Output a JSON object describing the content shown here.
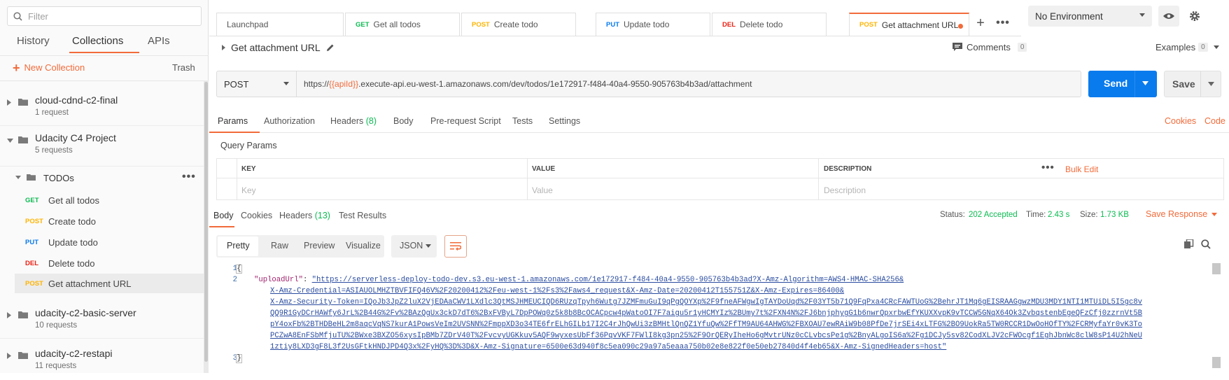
{
  "sidebar": {
    "search_placeholder": "Filter",
    "tabs": [
      "History",
      "Collections",
      "APIs"
    ],
    "new_collection": "New Collection",
    "trash": "Trash",
    "collections": [
      {
        "name": "cloud-cdnd-c2-final",
        "sub": "1 request"
      },
      {
        "name": "Udacity C4 Project",
        "sub": "5 requests"
      },
      {
        "name": "udacity-c2-basic-server",
        "sub": "10 requests"
      },
      {
        "name": "udacity-c2-restapi",
        "sub": "11 requests"
      }
    ],
    "folder": {
      "name": "TODOs"
    },
    "requests": [
      {
        "method": "GET",
        "title": "Get all todos"
      },
      {
        "method": "POST",
        "title": "Create todo"
      },
      {
        "method": "PUT",
        "title": "Update todo"
      },
      {
        "method": "DEL",
        "title": "Delete todo"
      },
      {
        "method": "POST",
        "title": "Get attachment URL"
      }
    ]
  },
  "tabs": [
    {
      "method": "",
      "title": "Launchpad"
    },
    {
      "method": "GET",
      "title": "Get all todos"
    },
    {
      "method": "POST",
      "title": "Create todo"
    },
    {
      "method": "PUT",
      "title": "Update todo"
    },
    {
      "method": "DEL",
      "title": "Delete todo"
    },
    {
      "method": "POST",
      "title": "Get attachment URL"
    }
  ],
  "environment": "No Environment",
  "request": {
    "title": "Get attachment URL",
    "comments_label": "Comments",
    "comments_count": "0",
    "examples_label": "Examples",
    "examples_count": "0",
    "method": "POST",
    "url_prefix": "https://",
    "url_var": "{{apiId}}",
    "url_rest": ".execute-api.eu-west-1.amazonaws.com/dev/todos/1e172917-f484-40a4-9550-905763b4b3ad/attachment",
    "send": "Send",
    "save": "Save"
  },
  "request_tabs": {
    "params": "Params",
    "authorization": "Authorization",
    "headers": "Headers",
    "headers_count": "(8)",
    "body": "Body",
    "prerequest": "Pre-request Script",
    "tests": "Tests",
    "settings": "Settings",
    "cookies": "Cookies",
    "code": "Code"
  },
  "query_params": {
    "title": "Query Params",
    "columns": [
      "KEY",
      "VALUE",
      "DESCRIPTION"
    ],
    "placeholders": [
      "Key",
      "Value",
      "Description"
    ],
    "bulk_edit": "Bulk Edit"
  },
  "response": {
    "tabs": [
      "Body",
      "Cookies",
      "Headers",
      "Test Results"
    ],
    "headers_count": "(13)",
    "status_label": "Status:",
    "status_value": "202 Accepted",
    "time_label": "Time:",
    "time_value": "2.43 s",
    "size_label": "Size:",
    "size_value": "1.73 KB",
    "save_response": "Save Response",
    "views": [
      "Pretty",
      "Raw",
      "Preview",
      "Visualize"
    ],
    "format": "JSON",
    "line_numbers": [
      "1",
      "2",
      "3"
    ],
    "open_brace": "{",
    "close_brace": "}",
    "key": "\"uploadUrl\"",
    "colon": ": ",
    "url_lines": [
      "\"https://serverless-deploy-todo-dev.s3.eu-west-1.amazonaws.com/1e172917-f484-40a4-9550-905763b4b3ad?X-Amz-Algorithm=AWS4-HMAC-SHA256&",
      "X-Amz-Credential=ASIAUOLMHZTBVFIFQ46V%2F20200412%2Feu-west-1%2Fs3%2Faws4_request&X-Amz-Date=20200412T155751Z&X-Amz-Expires=86400&",
      "X-Amz-Security-Token=IQoJb3JpZ2luX2VjEDAaCWV1LXdlc3QtMSJHMEUCIQD6RUzqTpyh6Wutg7JZMFmuGuI9qPgQOYXp%2F9fneAFWgwIgTAYDoUqd%2F03YT5b71Q9FqPxa4CRcFAWTUoG%2BehrJT1Mq6gEISRAAGgwzMDU3MDY1NTI1MTUiDL5I5gc8v",
      "QQ9R1GyDCrHAWfy6JrL%2B44G%2Fv%2BAzQgUx3ckD7dT6%2BxFVByL7DpPOWq0z5k8b8BcOCACpcw4pWatoOI7F7aigu5r1yHCMYIz%2BUmy7t%2FXN4N%2FJ6bnjphygG1b6nwrQpxrbwEfYKUXXvpK9vTCCW5GNqX64Ok3ZvbqstenbEgeQFzCfj0zzrnVt5B",
      "pY4oxFb%2BTHDBeHL2m8aqcVqNS7kurA1PowsVeIm2UVSNN%2FmppXD3o34TE6frELhGILb17I2C4rJhQwUi3zBMHtlQnQZ1YfuQw%2FfTM9AU64AHWG%2FBXOAU7ewRAiW9b08PfDe7jrSEi4xLTFG%2BO9UokRa5TW0RCCR1DwOoHOfTY%2FCRMyfaYr0vK3To",
      "PCZwA8EnFSbMfjuTU%2BWxe3BXZO56xysIpBMb7ZDrV40T%2FvcvyUGKkuv5AQF9wyxesUbFf36PqvVKF7FWlI8kg3pn25%2F9OrQERyIheHo6gMvtrUNz0cCLvbcsPe1g%2BnyALgoIS6a%2Fg1DCJy5sv82CodXLJV2cFWOcgf1EghJbnWc8clW8sP14U2hNeU",
      "1ztiy8LXD3gF8L3f2UsGFtkHNDJPD4Q3x%2FyHQ%3D%3D&X-Amz-Signature=6500e63d940f8c5ea090c29a97a5eaaa750b02e8e822f0e50eb27840d4f4eb65&X-Amz-SignedHeaders=host\""
    ]
  },
  "colors": {
    "accent": "#f26b3a",
    "send": "#097bed",
    "get": "#0cbb52",
    "post": "#ffb400",
    "put": "#097bed",
    "delete": "#eb2013"
  }
}
